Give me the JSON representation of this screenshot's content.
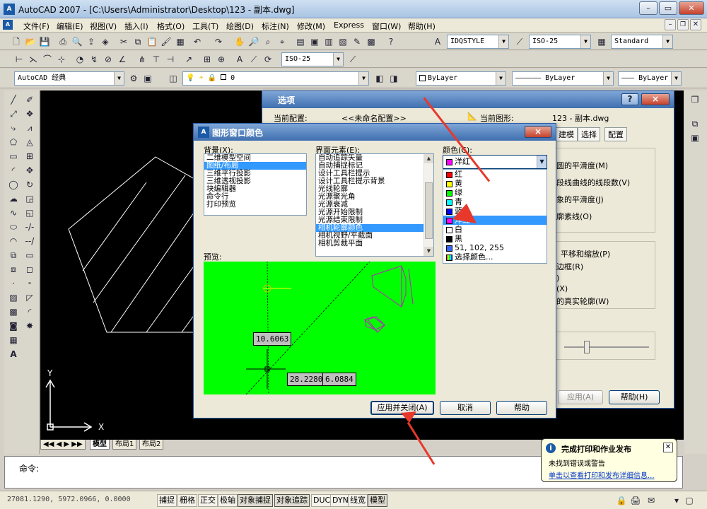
{
  "app": {
    "title": "AutoCAD 2007 - [C:\\Users\\Administrator\\Desktop\\123 - 副本.dwg]",
    "icon_label": "A"
  },
  "menu": [
    "文件(F)",
    "编辑(E)",
    "视图(V)",
    "插入(I)",
    "格式(O)",
    "工具(T)",
    "绘图(D)",
    "标注(N)",
    "修改(M)",
    "Express",
    "窗口(W)",
    "帮助(H)"
  ],
  "toolbar": {
    "text_style": "IDQSTYLE",
    "dim_style": "ISO-25",
    "table_style": "Standard",
    "dim_style2": "ISO-25",
    "workspace": "AutoCAD 经典",
    "layer": "0",
    "color": "ByLayer",
    "linetype": "ByLayer",
    "lineweight": "ByLayer"
  },
  "tabs": [
    "模型",
    "布局1",
    "布局2"
  ],
  "command": {
    "prompt": "命令:"
  },
  "status": {
    "coords": "27081.1290, 5972.0966, 0.0000",
    "buttons": [
      "捕捉",
      "栅格",
      "正交",
      "极轴",
      "对象捕捉",
      "对象追踪",
      "DUCS",
      "DYN",
      "线宽",
      "模型"
    ]
  },
  "options_dialog": {
    "title": "选项",
    "current_profile_label": "当前配置:",
    "current_profile": "<<未命名配置>>",
    "current_drawing_label": "当前图形:",
    "current_drawing": "123 - 副本.dwg",
    "tabs": [
      "建模",
      "选择",
      "配置"
    ],
    "items": [
      "圆的平滑度(M)",
      "段线曲线的线段数(V)",
      "象的平滑度(J)",
      "廓素线(O)",
      "平移和缩放(P)",
      "边框(R)",
      ")",
      "(X)",
      "的真实轮廓(W)"
    ],
    "apply": "应用(A)",
    "help": "帮助(H)",
    "help_btn": "?",
    "close_btn": "×"
  },
  "color_dialog": {
    "title": "图形窗口颜色",
    "close_btn": "×",
    "background_label": "背景(X):",
    "backgrounds": [
      "二维模型空间",
      "图纸/布局",
      "三维平行投影",
      "三维透视投影",
      "块编辑器",
      "命令行",
      "打印预览"
    ],
    "background_selected": 1,
    "element_label": "界面元素(E):",
    "elements": [
      "自动追踪矢量",
      "自动捕捉标记",
      "设计工具栏提示",
      "设计工具栏提示背景",
      "光线轮廓",
      "光源聚光角",
      "光源衰减",
      "光源开始限制",
      "光源结束限制",
      "相机轮廓颜色",
      "相机视野/平截面",
      "相机剪裁平面"
    ],
    "element_selected": 9,
    "color_label": "颜色(C):",
    "color_current": "洋红",
    "colors": [
      {
        "name": "红",
        "hex": "#ff0000"
      },
      {
        "name": "黄",
        "hex": "#ffff00"
      },
      {
        "name": "绿",
        "hex": "#00ff00"
      },
      {
        "name": "青",
        "hex": "#00ffff"
      },
      {
        "name": "蓝",
        "hex": "#0000ff"
      },
      {
        "name": "洋红",
        "hex": "#ff00ff"
      },
      {
        "name": "白",
        "hex": "#ffffff"
      },
      {
        "name": "黑",
        "hex": "#000000"
      },
      {
        "name": "51, 102, 255",
        "hex": "#3366ff"
      },
      {
        "name": "选择颜色...",
        "hex": "#ffffff"
      }
    ],
    "color_selected": 5,
    "preview_label": "预览:",
    "preview_bg": "#00ff00",
    "preview_values": [
      "10.6063",
      "28.2280",
      "6.0884"
    ],
    "apply_close": "应用并关闭(A)",
    "cancel": "取消",
    "help": "帮助"
  },
  "balloon": {
    "title": "完成打印和作业发布",
    "line1": "未找到错误或警告",
    "link": "单击以查看打印和发布详细信息..."
  },
  "colors": {
    "canvas": "#000000",
    "selection": "#3399ff",
    "arrow": "#e8382c"
  }
}
